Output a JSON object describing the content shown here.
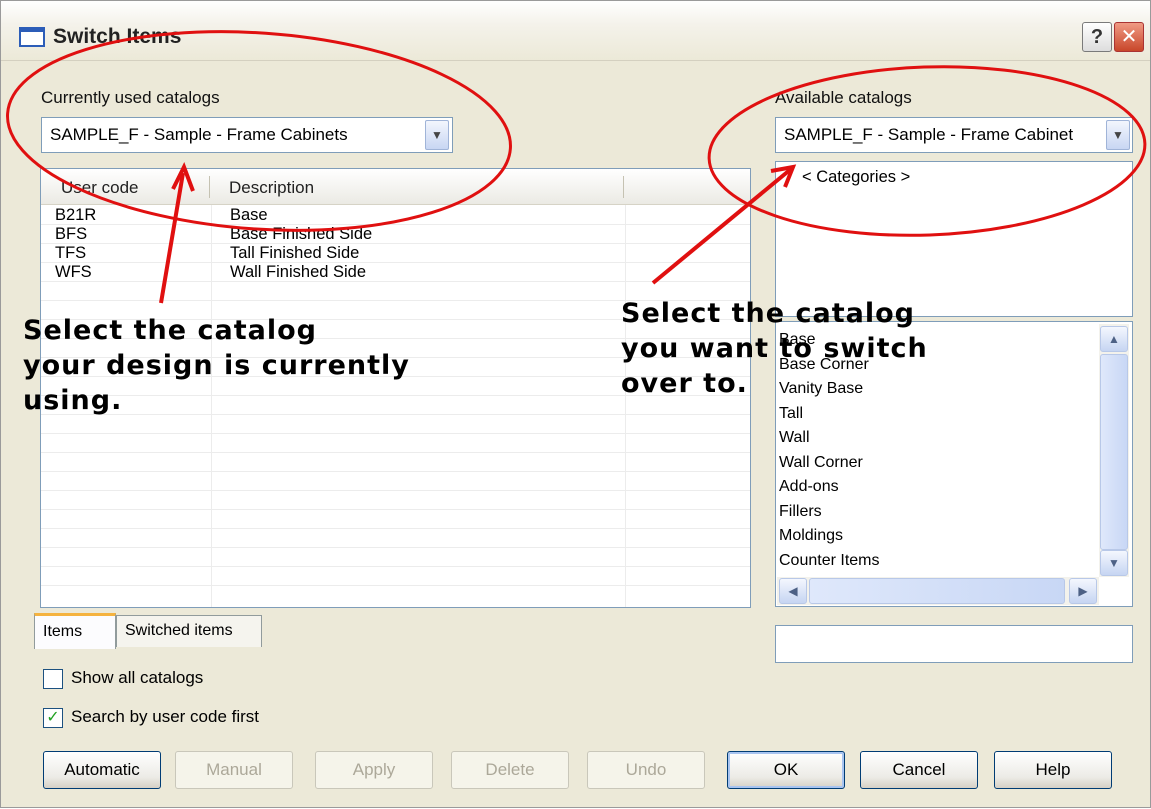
{
  "window": {
    "title": "Switch Items",
    "help_glyph": "?",
    "close_glyph": "✕"
  },
  "left": {
    "label": "Currently used catalogs",
    "combo_value": "SAMPLE_F - Sample - Frame Cabinets",
    "columns": [
      "User code",
      "Description"
    ],
    "rows": [
      {
        "code": "B21R",
        "desc": "Base"
      },
      {
        "code": "BFS",
        "desc": "Base Finished Side"
      },
      {
        "code": "TFS",
        "desc": "Tall Finished Side"
      },
      {
        "code": "WFS",
        "desc": "Wall Finished Side"
      }
    ]
  },
  "right": {
    "label": "Available catalogs",
    "combo_value": "SAMPLE_F - Sample - Frame Cabinet",
    "categories_item": "< Categories >",
    "items": [
      "Base",
      "Base Corner",
      "Vanity Base",
      "Tall",
      "Wall",
      "Wall Corner",
      "Add-ons",
      "Fillers",
      "Moldings",
      "Counter Items"
    ],
    "search_value": ""
  },
  "tabs": [
    "Items",
    "Switched items"
  ],
  "options": {
    "show_all": {
      "label": "Show all catalogs",
      "checked": false
    },
    "search_first": {
      "label": "Search by user code first",
      "checked": true
    }
  },
  "buttons": {
    "automatic": "Automatic",
    "manual": "Manual",
    "apply": "Apply",
    "delete": "Delete",
    "undo": "Undo",
    "ok": "OK",
    "cancel": "Cancel",
    "help": "Help"
  },
  "annotations": {
    "left_text": "Select the catalog\nyour design is currently\nusing.",
    "right_text": "Select the catalog\nyou want to switch\nover to.",
    "color": "#e01010"
  },
  "icons": {
    "dropdown": "▼",
    "up": "▲",
    "down": "▼",
    "left": "◀",
    "right": "▶",
    "check": "✓"
  },
  "colors": {
    "dialog_bg": "#ece9d8",
    "border": "#7f9db9",
    "tab_accent": "#f5b33f"
  }
}
